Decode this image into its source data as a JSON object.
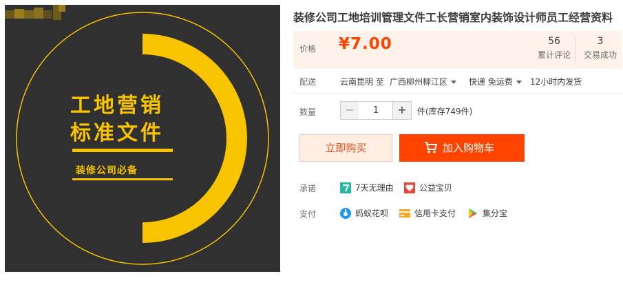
{
  "product_image": {
    "headline_line1": "工地营销",
    "headline_line2": "标准文件",
    "subline": "装修公司必备",
    "colors": {
      "background": "#303030",
      "accent": "#f8c400"
    }
  },
  "product": {
    "title": "装修公司工地培训管理文件工长营销室内装饰设计师员工经营资料"
  },
  "price": {
    "label": "价格",
    "currency": "¥",
    "value": "7.00",
    "reviews_count": "56",
    "reviews_label": "累计评论",
    "sales_count": "3",
    "sales_label": "交易成功"
  },
  "shipping": {
    "label": "配送",
    "from": "云南昆明 至",
    "to": "广西柳州柳江区",
    "method": "快递 免运费",
    "dispatch": "12小时内发货"
  },
  "quantity": {
    "label": "数量",
    "minus": "−",
    "value": "1",
    "plus": "+",
    "stock": "件(库存749件)"
  },
  "actions": {
    "buy_now": "立即购买",
    "add_to_cart": "加入购物车"
  },
  "promise": {
    "label": "承诺",
    "items": [
      {
        "icon": "seven-day-return-icon",
        "text": "7天无理由"
      },
      {
        "icon": "charity-heart-icon",
        "text": "公益宝贝"
      }
    ]
  },
  "payment": {
    "label": "支付",
    "items": [
      {
        "icon": "huabei-icon",
        "text": "蚂蚁花呗"
      },
      {
        "icon": "credit-card-icon",
        "text": "信用卡支付"
      },
      {
        "icon": "jifenbao-icon",
        "text": "集分宝"
      }
    ]
  },
  "colors": {
    "accent": "#ff4400",
    "price_bg": "#fff2e8"
  }
}
